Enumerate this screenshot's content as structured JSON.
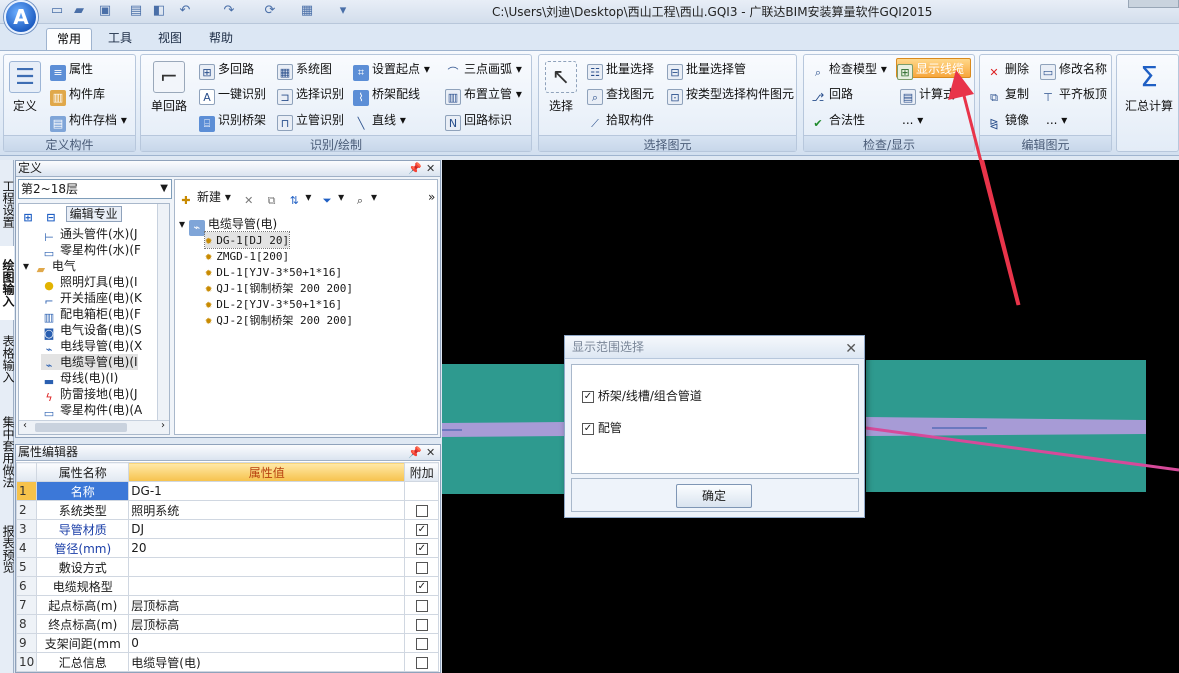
{
  "app": {
    "logo": "A",
    "window_title": "C:\\Users\\刘迪\\Desktop\\西山工程\\西山.GQI3 - 广联达BIM安装算量软件GQI2015"
  },
  "quick_access": [
    "new-file-icon",
    "open-folder-icon",
    "save-icon",
    "print-icon",
    "import-icon",
    "undo-icon",
    "redo-icon",
    "refresh-icon",
    "view-icon",
    "customize-icon"
  ],
  "tabs": [
    "常用",
    "工具",
    "视图",
    "帮助"
  ],
  "ribbon": {
    "groups": {
      "define": "定义构件",
      "draw": "识别/绘制",
      "select": "选择图元",
      "check": "检查/显示",
      "edit": "编辑图元"
    },
    "define": {
      "big": "定义",
      "attr": "属性",
      "lib": "构件库",
      "store": "构件存档"
    },
    "draw": {
      "big": "单回路",
      "multi": "多回路",
      "one_key": "一键识别",
      "bridge_id": "识别桥架",
      "system": "系统图",
      "select_id": "选择识别",
      "riser_id": "立管识别",
      "set_start": "设置起点",
      "bridge_wire": "桥架配线",
      "line": "直线",
      "arc3": "三点画弧",
      "place_riser": "布置立管",
      "loop_tag": "回路标识"
    },
    "select": {
      "big": "选择",
      "batch": "批量选择",
      "find": "查找图元",
      "pick": "拾取构件",
      "batch_riser": "批量选择管",
      "by_type": "按类型选择构件图元"
    },
    "check": {
      "check_model": "检查模型",
      "loop": "回路",
      "legal": "合法性",
      "show_cable": "显示线缆",
      "formula": "计算式",
      "more": "..."
    },
    "edit": {
      "delete": "删除",
      "copy": "复制",
      "mirror": "镜像",
      "rename": "修改名称",
      "align_top": "平齐板顶",
      "more": "..."
    },
    "sum": "汇总计算"
  },
  "left_nav": [
    "工程设置",
    "绘图输入",
    "表格输入",
    "集中套用做法",
    "报表预览"
  ],
  "definition_panel": {
    "title": "定义",
    "floor": "第2~18层",
    "edit_specialty": "编辑专业",
    "left_tree": [
      {
        "label": "通头管件(水)(J",
        "icon": "fitting-icon",
        "indent": 2
      },
      {
        "label": "零星构件(水)(F",
        "icon": "misc-icon",
        "indent": 2
      },
      {
        "label": "电气",
        "icon": "folder-icon",
        "indent": 1
      },
      {
        "label": "照明灯具(电)(I",
        "icon": "lamp-icon",
        "indent": 2
      },
      {
        "label": "开关插座(电)(K",
        "icon": "switch-icon",
        "indent": 2
      },
      {
        "label": "配电箱柜(电)(F",
        "icon": "cabinet-icon",
        "indent": 2
      },
      {
        "label": "电气设备(电)(S",
        "icon": "device-icon",
        "indent": 2
      },
      {
        "label": "电线导管(电)(X",
        "icon": "wire-icon",
        "indent": 2
      },
      {
        "label": "电缆导管(电)(I",
        "icon": "cable-icon",
        "indent": 2,
        "selected": true
      },
      {
        "label": "母线(电)(I)",
        "icon": "busbar-icon",
        "indent": 2
      },
      {
        "label": "防雷接地(电)(J",
        "icon": "lightning-icon",
        "indent": 2
      },
      {
        "label": "零星构件(电)(A",
        "icon": "misc-icon",
        "indent": 2
      }
    ],
    "toolbar": {
      "new": "新建"
    },
    "right_tree_root": "电缆导管(电)",
    "right_tree": [
      {
        "label": "DG-1[DJ 20]",
        "selected": true
      },
      {
        "label": "ZMGD-1[200]"
      },
      {
        "label": "DL-1[YJV-3*50+1*16]"
      },
      {
        "label": "QJ-1[钢制桥架 200 200]"
      },
      {
        "label": "DL-2[YJV-3*50+1*16]"
      },
      {
        "label": "QJ-2[钢制桥架 200 200]"
      }
    ]
  },
  "property_editor": {
    "title": "属性编辑器",
    "headers": {
      "name": "属性名称",
      "value": "属性值",
      "extra": "附加"
    },
    "rows": [
      {
        "no": "1",
        "name": "名称",
        "value": "DG-1",
        "blue": true,
        "selected": true,
        "check": null
      },
      {
        "no": "2",
        "name": "系统类型",
        "value": "照明系统",
        "check": false
      },
      {
        "no": "3",
        "name": "导管材质",
        "value": "DJ",
        "blue": true,
        "check": true
      },
      {
        "no": "4",
        "name": "管径(mm)",
        "value": "20",
        "blue": true,
        "check": true
      },
      {
        "no": "5",
        "name": "敷设方式",
        "value": "",
        "check": false
      },
      {
        "no": "6",
        "name": "电缆规格型",
        "value": "",
        "check": true
      },
      {
        "no": "7",
        "name": "起点标高(m)",
        "value": "层顶标高",
        "check": false
      },
      {
        "no": "8",
        "name": "终点标高(m)",
        "value": "层顶标高",
        "check": false
      },
      {
        "no": "9",
        "name": "支架间距(mm",
        "value": "0",
        "check": false
      },
      {
        "no": "10",
        "name": "汇总信息",
        "value": "电缆导管(电)",
        "check": false
      }
    ]
  },
  "dialog": {
    "title": "显示范围选择",
    "options": [
      {
        "label": "桥架/线槽/组合管道",
        "checked": true
      },
      {
        "label": "配管",
        "checked": true
      }
    ],
    "ok": "确定"
  },
  "colors": {
    "canvas": "#000000",
    "slab": "#2e9a8f",
    "pipe": "#a79bd6",
    "annotation_arrow": "#e8344a",
    "highlight": "#f7a63c"
  }
}
